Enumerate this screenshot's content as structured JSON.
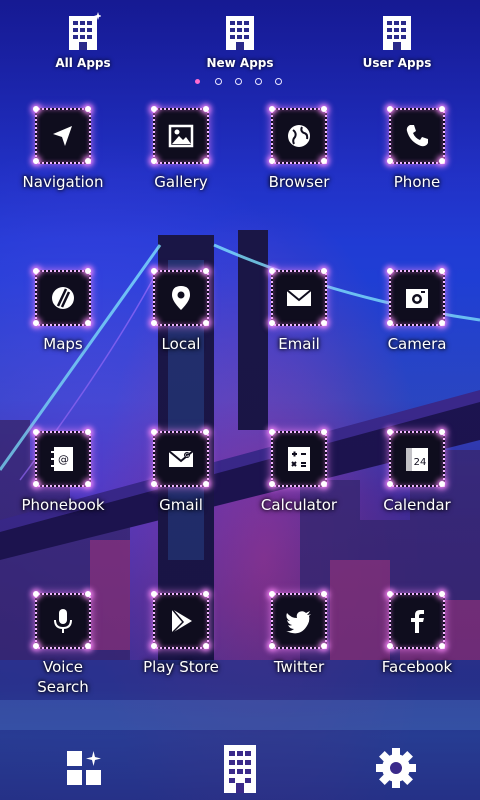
{
  "tabs": [
    {
      "label": "All Apps",
      "icon": "building-sparkle-icon"
    },
    {
      "label": "New Apps",
      "icon": "building-icon"
    },
    {
      "label": "User Apps",
      "icon": "building-icon"
    }
  ],
  "pager": {
    "count": 5,
    "active": 0
  },
  "apps": [
    {
      "label": "Navigation",
      "icon": "navigation-arrow-icon"
    },
    {
      "label": "Gallery",
      "icon": "picture-icon"
    },
    {
      "label": "Browser",
      "icon": "globe-icon"
    },
    {
      "label": "Phone",
      "icon": "phone-icon"
    },
    {
      "label": "Maps",
      "icon": "map-icon"
    },
    {
      "label": "Local",
      "icon": "map-pin-icon"
    },
    {
      "label": "Email",
      "icon": "envelope-icon"
    },
    {
      "label": "Camera",
      "icon": "camera-icon"
    },
    {
      "label": "Phonebook",
      "icon": "address-book-icon"
    },
    {
      "label": "Gmail",
      "icon": "gmail-envelope-icon"
    },
    {
      "label": "Calculator",
      "icon": "calculator-icon"
    },
    {
      "label": "Calendar",
      "icon": "calendar-icon"
    },
    {
      "label": "Voice\nSearch",
      "icon": "microphone-icon"
    },
    {
      "label": "Play Store",
      "icon": "play-store-icon"
    },
    {
      "label": "Twitter",
      "icon": "twitter-bird-icon"
    },
    {
      "label": "Facebook",
      "icon": "facebook-f-icon"
    }
  ],
  "calendar_day": "24",
  "dock": [
    {
      "icon": "widgets-icon"
    },
    {
      "icon": "building-icon"
    },
    {
      "icon": "gear-icon"
    }
  ],
  "colors": {
    "accent": "#ff8cff",
    "tile": "#0f0d1e",
    "text": "#ffffff"
  }
}
